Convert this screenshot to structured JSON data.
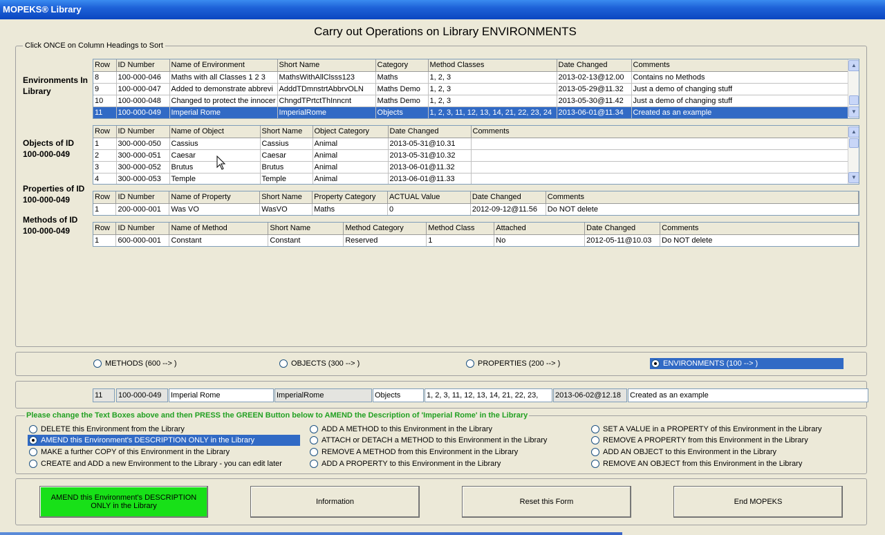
{
  "window": {
    "title": "MOPEKS® Library"
  },
  "heading": "Carry out Operations on Library ENVIRONMENTS",
  "sort_hint": "Click ONCE on Column Headings to Sort",
  "sections": {
    "environments": "Environments In Library",
    "objects": "Objects of ID 100-000-049",
    "properties": "Properties of ID 100-000-049",
    "methods": "Methods of ID 100-000-049"
  },
  "environments_table": {
    "columns": [
      "Row",
      "ID Number",
      "Name of Environment",
      "Short Name",
      "Category",
      "Method Classes",
      "Date Changed",
      "Comments"
    ],
    "rows": [
      [
        "8",
        "100-000-046",
        "Maths with all Classes 1 2 3",
        "MathsWithAllClsss123",
        "Maths",
        "1, 2, 3",
        "2013-02-13@12.00",
        "Contains no Methods"
      ],
      [
        "9",
        "100-000-047",
        "Added to demonstrate abbrevi",
        "AdddTDmnstrtAbbrvOLN",
        "Maths Demo",
        "1, 2, 3",
        "2013-05-29@11.32",
        "Just a demo of changing stuff"
      ],
      [
        "10",
        "100-000-048",
        "Changed to protect the innocer",
        "ChngdTPrtctThInncnt",
        "Maths Demo",
        "1, 2, 3",
        "2013-05-30@11.42",
        "Just a demo of changing stuff"
      ],
      [
        "11",
        "100-000-049",
        "Imperial Rome",
        "ImperialRome",
        "Objects",
        "1, 2, 3, 11, 12, 13, 14, 21, 22, 23, 24",
        "2013-06-01@11.34",
        "Created as an example"
      ]
    ],
    "selected_row": 3
  },
  "objects_table": {
    "columns": [
      "Row",
      "ID Number",
      "Name of Object",
      "Short Name",
      "Object Category",
      "Date Changed",
      "Comments"
    ],
    "rows": [
      [
        "1",
        "300-000-050",
        "Cassius",
        "Cassius",
        "Animal",
        "2013-05-31@10.31",
        ""
      ],
      [
        "2",
        "300-000-051",
        "Caesar",
        "Caesar",
        "Animal",
        "2013-05-31@10.32",
        ""
      ],
      [
        "3",
        "300-000-052",
        "Brutus",
        "Brutus",
        "Animal",
        "2013-06-01@11.32",
        ""
      ],
      [
        "4",
        "300-000-053",
        "Temple",
        "Temple",
        "Animal",
        "2013-06-01@11.33",
        ""
      ]
    ]
  },
  "properties_table": {
    "columns": [
      "Row",
      "ID Number",
      "Name of Property",
      "Short Name",
      "Property Category",
      "ACTUAL Value",
      "Date Changed",
      "Comments"
    ],
    "rows": [
      [
        "1",
        "200-000-001",
        "Was VO",
        "WasVO",
        "Maths",
        "0",
        "2012-09-12@11.56",
        "Do NOT delete"
      ]
    ]
  },
  "methods_table": {
    "columns": [
      "Row",
      "ID Number",
      "Name of Method",
      "Short Name",
      "Method Category",
      "Method Class",
      "Attached",
      "Date Changed",
      "Comments"
    ],
    "rows": [
      [
        "1",
        "600-000-001",
        "Constant",
        "Constant",
        "Reserved",
        "1",
        "No",
        "2012-05-11@10.03",
        "Do NOT delete"
      ]
    ]
  },
  "library_types": {
    "methods": "METHODS (600 --> )",
    "objects": "OBJECTS (300 --> )",
    "properties": "PROPERTIES (200 --> )",
    "environments": "ENVIRONMENTS (100 --> )",
    "selected": "environments"
  },
  "edit_fields": {
    "row": "11",
    "id": "100-000-049",
    "name": "Imperial Rome",
    "short_name": "ImperialRome",
    "category": "Objects",
    "method_classes": "1, 2, 3, 11, 12, 13, 14, 21, 22, 23,",
    "date_changed": "2013-06-02@12.18",
    "comments": "Created as an example"
  },
  "instruction": "Please change the Text Boxes above and then PRESS the GREEN Button below to AMEND the Description of 'Imperial Rome' in the Library",
  "operations": {
    "col1": [
      "DELETE this Environment from the Library",
      "AMEND this Environment's DESCRIPTION ONLY in the Library",
      "MAKE a further COPY of this Environment in the Library",
      "CREATE and ADD a new Environment to the Library - you can edit later"
    ],
    "col2": [
      "ADD A METHOD to this Environment in the Library",
      "ATTACH or DETACH a METHOD to this Environment in the Library",
      "REMOVE A METHOD from this Environment in the Library",
      "ADD A PROPERTY to this Environment in the Library"
    ],
    "col3": [
      "SET A VALUE in a PROPERTY of this Environment in the Library",
      "REMOVE A PROPERTY from this Environment in the Library",
      "ADD AN OBJECT to this Environment in the Library",
      "REMOVE  AN OBJECT from this Environment in the Library"
    ],
    "selected": "col1.1"
  },
  "buttons": {
    "amend": "AMEND this Environment's DESCRIPTION ONLY in the Library",
    "information": "Information",
    "reset": "Reset this Form",
    "end": "End MOPEKS"
  },
  "colors": {
    "selection": "#316ac5",
    "green_button": "#18e018",
    "instruction": "#22a022"
  }
}
